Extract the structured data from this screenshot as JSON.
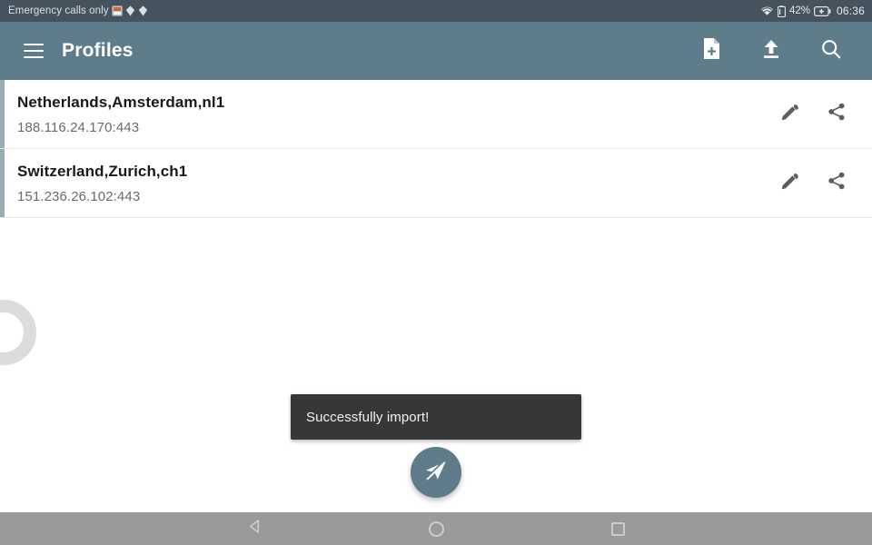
{
  "statusbar": {
    "carrier_text": "Emergency calls only",
    "icons": [
      "sim-card-icon",
      "diamond-icon",
      "diamond-icon"
    ],
    "wifi_icon": "wifi-icon",
    "battery_icon": "battery-icon",
    "battery_percent": "42%",
    "charging_icon": "battery-charging-icon",
    "time": "06:36",
    "bg_color": "#44535d"
  },
  "appbar": {
    "menu_icon": "hamburger-menu-icon",
    "title": "Profiles",
    "bg_color": "#5f7c8a",
    "actions": [
      {
        "name": "add-profile-button",
        "icon": "file-add-icon"
      },
      {
        "name": "import-button",
        "icon": "upload-icon"
      },
      {
        "name": "search-button",
        "icon": "search-icon"
      }
    ]
  },
  "profiles": [
    {
      "title": "Netherlands,Amsterdam,nl1",
      "address": "188.116.24.170:443",
      "edit_icon": "pencil-icon",
      "share_icon": "share-icon",
      "accent_color": "#9aadb7"
    },
    {
      "title": "Switzerland,Zurich,ch1",
      "address": "151.236.26.102:443",
      "edit_icon": "pencil-icon",
      "share_icon": "share-icon",
      "accent_color": "#9aadb7"
    }
  ],
  "toast": {
    "message": "Successfully import!",
    "bg_color": "#373737"
  },
  "fab": {
    "icon": "send-disabled-icon",
    "bg_color": "#5f7c8a"
  },
  "navbar": {
    "back_icon": "nav-back-icon",
    "home_icon": "nav-home-icon",
    "recents_icon": "nav-recents-icon",
    "bg_color": "#9a9a9a"
  },
  "decoration": {
    "ring": "loading-ring-decoration"
  }
}
